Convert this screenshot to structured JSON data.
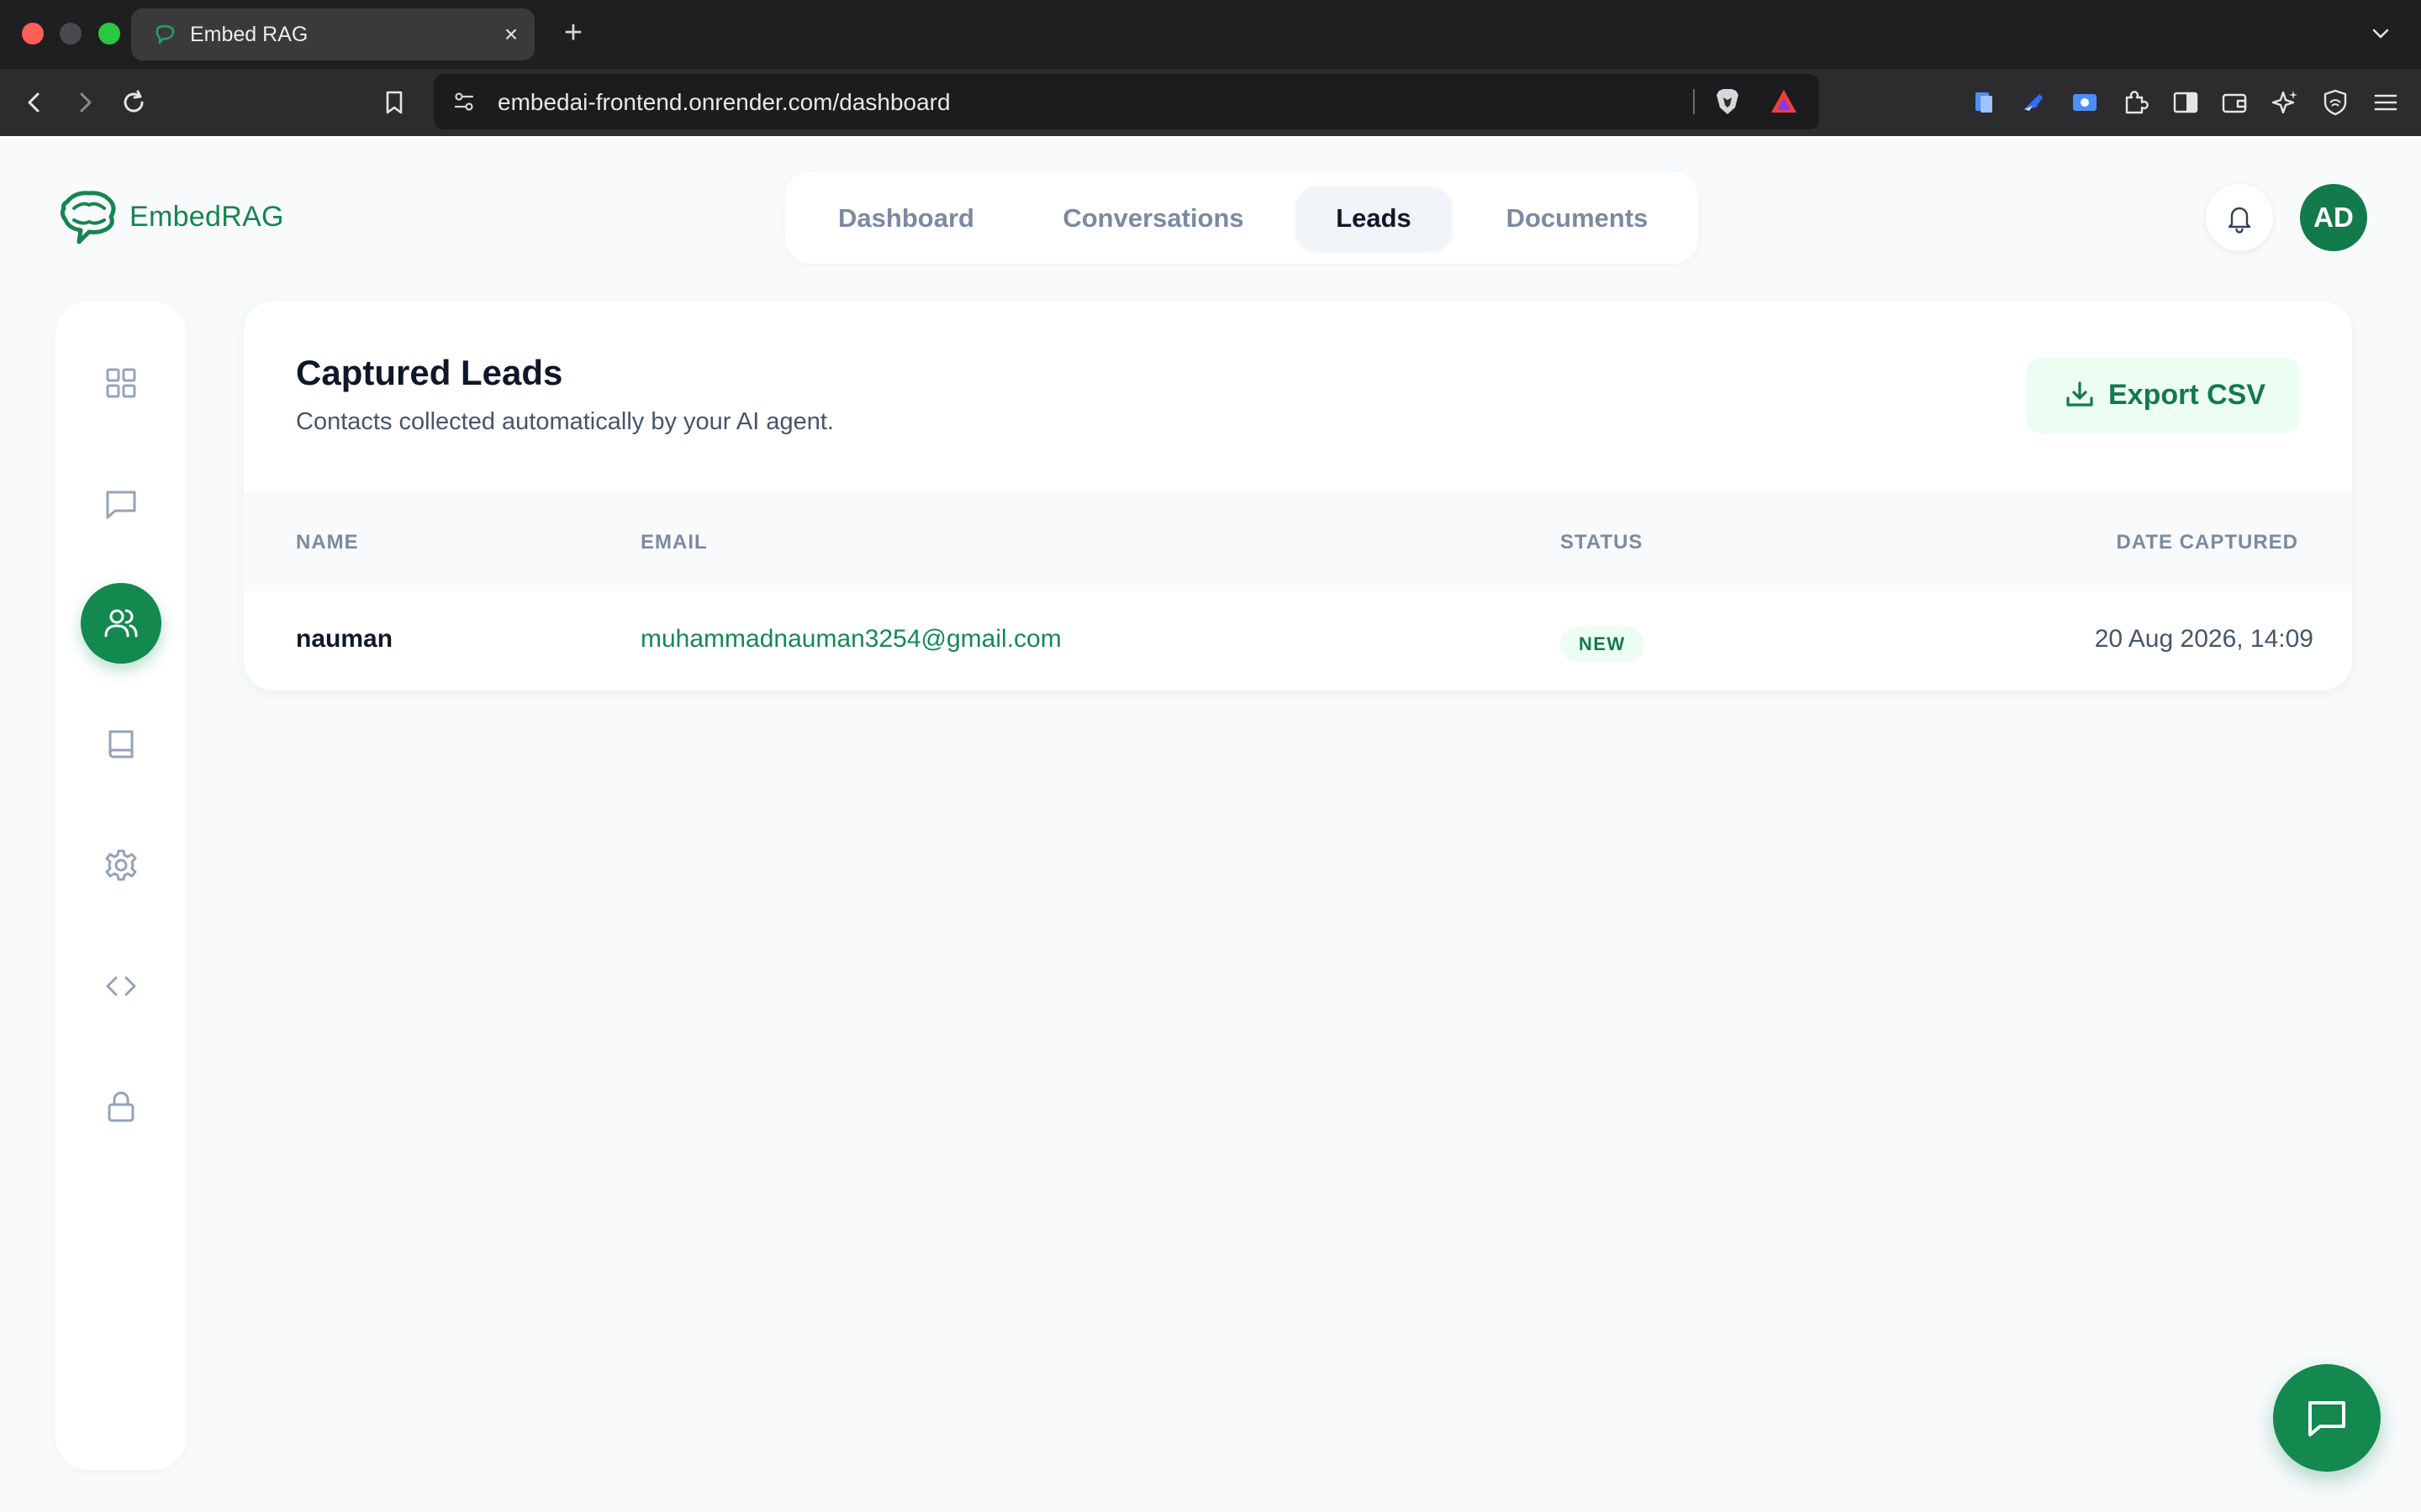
{
  "browser": {
    "tab_title": "Embed RAG",
    "tab_close": "×",
    "new_tab": "+",
    "url": "embedai-frontend.onrender.com/dashboard"
  },
  "brand": {
    "name": "EmbedRAG",
    "accent_color": "#13884f"
  },
  "topnav": {
    "items": [
      {
        "label": "Dashboard",
        "active": false
      },
      {
        "label": "Conversations",
        "active": false
      },
      {
        "label": "Leads",
        "active": true
      },
      {
        "label": "Documents",
        "active": false
      }
    ]
  },
  "header": {
    "avatar_initials": "AD"
  },
  "sidebar": {
    "items": [
      {
        "icon": "grid-icon",
        "active": false
      },
      {
        "icon": "chat-icon",
        "active": false
      },
      {
        "icon": "users-icon",
        "active": true
      },
      {
        "icon": "book-icon",
        "active": false
      },
      {
        "icon": "gear-icon",
        "active": false
      },
      {
        "icon": "code-icon",
        "active": false
      },
      {
        "icon": "lock-icon",
        "active": false
      }
    ]
  },
  "leads": {
    "title": "Captured Leads",
    "subtitle": "Contacts collected automatically by your AI agent.",
    "export_label": "Export CSV",
    "columns": {
      "name": "NAME",
      "email": "EMAIL",
      "status": "STATUS",
      "date": "DATE CAPTURED"
    },
    "rows": [
      {
        "name": "nauman",
        "email": "muhammadnauman3254@gmail.com",
        "status": "NEW",
        "date": "20 Aug 2026, 14:09"
      }
    ]
  }
}
